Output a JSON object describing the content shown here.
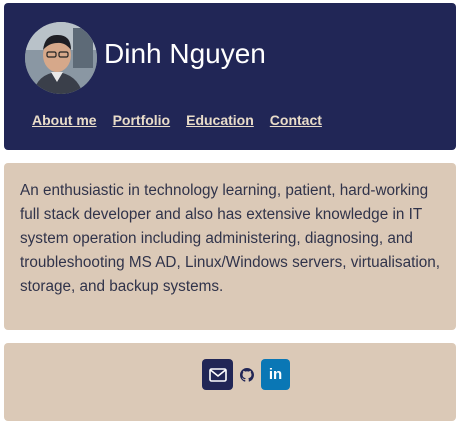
{
  "profile": {
    "name": "Dinh Nguyen",
    "avatar_alt": "profile photo"
  },
  "nav": {
    "items": [
      {
        "label": "About me"
      },
      {
        "label": "Portfolio"
      },
      {
        "label": "Education"
      },
      {
        "label": "Contact"
      }
    ]
  },
  "bio": {
    "text": "An enthusiastic in technology learning, patient, hard-working full stack developer and also has extensive knowledge in IT system operation including administering, diagnosing, and troubleshooting MS AD, Linux/Windows servers, virtualisation, storage, and backup systems."
  },
  "social": {
    "icons": {
      "mail": "envelope-icon",
      "github": "github-icon",
      "linkedin": "linkedin-icon"
    },
    "linkedin_glyph": "in"
  },
  "colors": {
    "header_bg": "#212656",
    "card_bg": "#dbc9b7",
    "nav_link": "#e9dcc9",
    "body_text": "#30334a",
    "linkedin": "#0a77b5"
  }
}
